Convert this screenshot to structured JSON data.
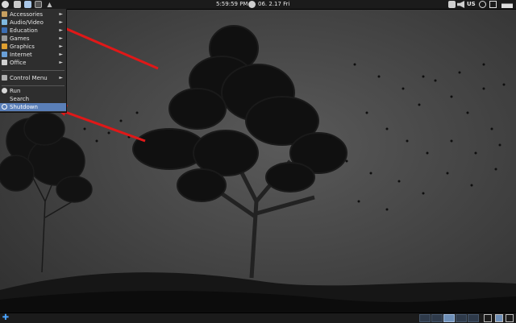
{
  "top_panel": {
    "clock": "5:59:59 PM",
    "date": "06. 2.17 Fri",
    "keyboard_layout": "US",
    "launchers": [
      "start-menu-icon",
      "file-manager-icon",
      "text-editor-icon",
      "terminal-icon",
      "up-arrow-icon"
    ],
    "tray": [
      "network-icon",
      "volume-icon",
      "power-icon",
      "battery-icon",
      "chart-icon"
    ]
  },
  "menu": {
    "items": [
      {
        "label": "Accessories",
        "submenu": true,
        "icon": "accessories-icon"
      },
      {
        "label": "Audio/Video",
        "submenu": true,
        "icon": "audio-video-icon"
      },
      {
        "label": "Education",
        "submenu": true,
        "icon": "education-icon"
      },
      {
        "label": "Games",
        "submenu": true,
        "icon": "games-icon"
      },
      {
        "label": "Graphics",
        "submenu": true,
        "icon": "graphics-icon"
      },
      {
        "label": "Internet",
        "submenu": true,
        "icon": "internet-icon"
      },
      {
        "label": "Office",
        "submenu": true,
        "icon": "office-icon"
      },
      {
        "label": "Control Menu",
        "submenu": true,
        "icon": "control-menu-icon"
      },
      {
        "label": "Run",
        "submenu": false,
        "icon": "run-icon"
      },
      {
        "label": "Search",
        "submenu": false,
        "icon": ""
      },
      {
        "label": "Shutdown",
        "submenu": false,
        "icon": "shutdown-icon",
        "selected": true
      }
    ],
    "arrow_glyph": "►"
  },
  "bottom_panel": {
    "start_glyph": "✚"
  },
  "colors": {
    "panel": "#1b1b1b",
    "menu": "#2e2e2e",
    "selection": "#5a7fb8",
    "annotation_arrow": "#e01818"
  }
}
